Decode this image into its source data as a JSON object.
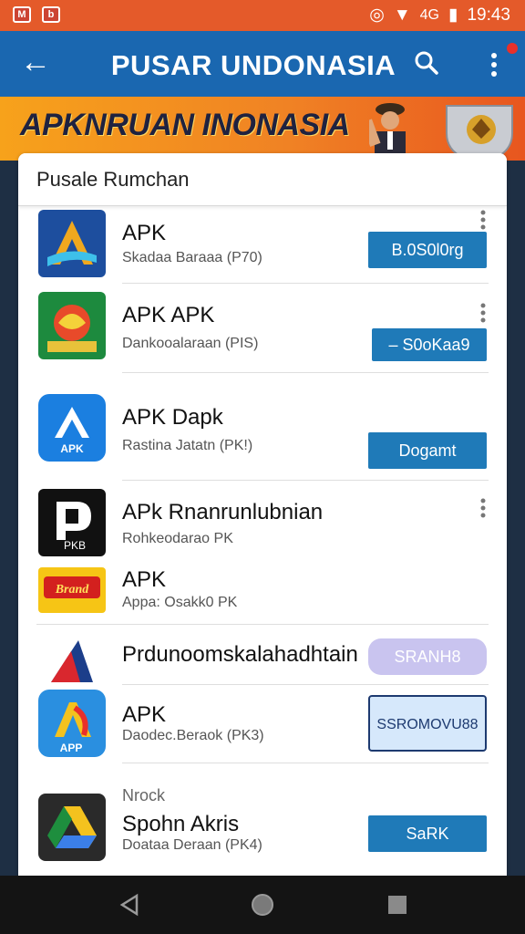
{
  "status_bar": {
    "time": "19:43",
    "signal_text": "4G"
  },
  "app_bar": {
    "title": "PUSAR UNDONASIA"
  },
  "banner": {
    "title": "APKNRUAN INONASIA"
  },
  "list": {
    "header": "Pusale Rumchan",
    "items": [
      {
        "name": "APK",
        "subtitle": "Skadaa Baraaa (P70)",
        "button": "B.0S0l0rg",
        "icon": "apk-a-logo-icon"
      },
      {
        "name": "APK APK",
        "subtitle": "Dankooalaraan (PIS)",
        "button": "– S0oKaa9",
        "icon": "garuda-emblem-icon"
      },
      {
        "name": "APK Dapk",
        "subtitle": "Rastina Jatatn (PK!)",
        "button": "Dogamt",
        "icon": "apk-blue-a-icon"
      },
      {
        "name": "APk Rnanrunlubnian",
        "subtitle": "Rohkeodarao PK",
        "button": "",
        "icon": "black-p-logo-icon"
      },
      {
        "name": "APK",
        "subtitle": "Appa: Osakk0 PK",
        "button": "",
        "icon": "red-yellow-badge-icon"
      },
      {
        "name": "Prdunoomskalahadhtain",
        "subtitle": "",
        "button": "SRANH8",
        "icon": "red-blue-triangle-icon"
      },
      {
        "name": "APK",
        "subtitle": "Daodec.Beraok (PK3)",
        "button": "SSROMOVU88",
        "icon": "app-a-gradient-icon"
      },
      {
        "name": "Spohn Akris",
        "subtitle": "Doataa Deraan (PK4)",
        "label_above": "Nrock",
        "button": "SaRK",
        "icon": "drive-triangle-icon"
      }
    ]
  }
}
